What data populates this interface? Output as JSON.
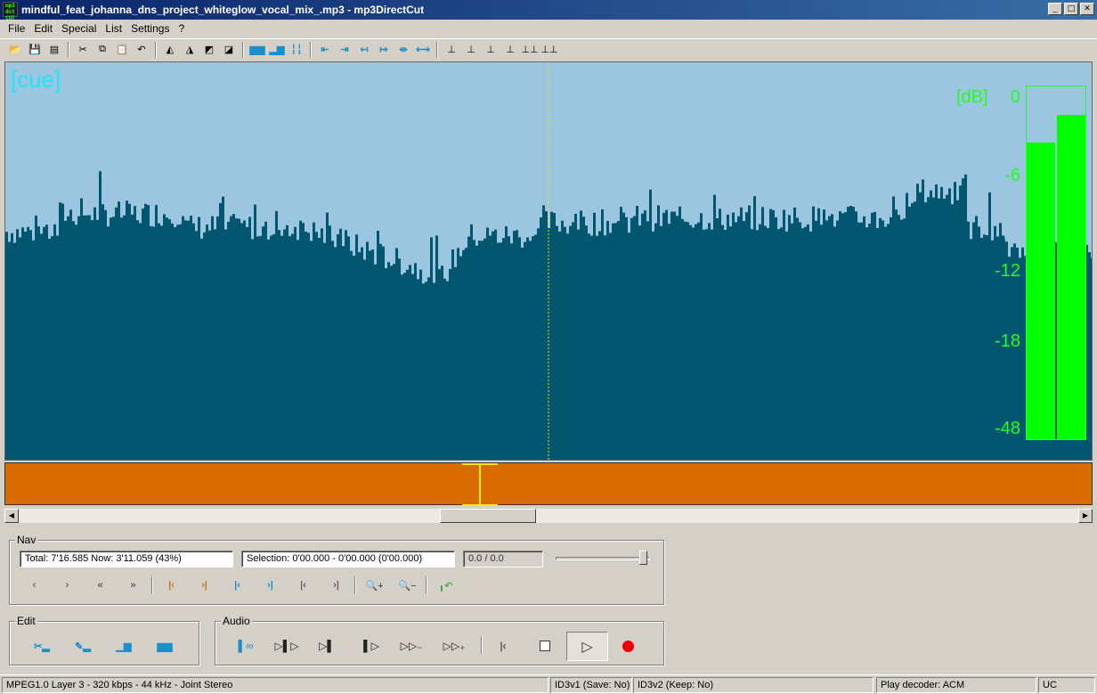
{
  "window": {
    "title": "mindful_feat_johanna_dns_project_whiteglow_vocal_mix_.mp3 - mp3DirectCut",
    "icon_text": "mp3 direct cut",
    "controls": [
      "minimize-icon",
      "maximize-icon",
      "close-icon"
    ]
  },
  "menu": [
    "File",
    "Edit",
    "Special",
    "List",
    "Settings",
    "?"
  ],
  "waveform": {
    "cue_label": "[cue]",
    "db_unit": "[dB]",
    "db_scale": [
      "0",
      "-6",
      "-12",
      "-18",
      "-48"
    ],
    "colors": {
      "background": "#9cc5e0",
      "wave": "#02566f",
      "vu": "#00ff00",
      "cursor": "#f0f000",
      "timeline": "#d86c00"
    },
    "vu_levels": {
      "left": 0.84,
      "right": 0.92
    }
  },
  "nav": {
    "group_label": "Nav",
    "total_now": "Total: 7'16.585   Now: 3'11.059   (43%)",
    "selection": "Selection: 0'00.000 - 0'00.000 (0'00.000)",
    "counter": "0.0 / 0.0",
    "volume_level": 0.97
  },
  "edit": {
    "group_label": "Edit"
  },
  "audio": {
    "group_label": "Audio"
  },
  "status": {
    "format": "MPEG1.0 Layer 3 - 320 kbps - 44 kHz - Joint Stereo",
    "id3v1": "ID3v1 (Save: No)",
    "id3v2": "ID3v2 (Keep: No)",
    "decoder": "Play decoder: ACM",
    "mode": "UC"
  }
}
